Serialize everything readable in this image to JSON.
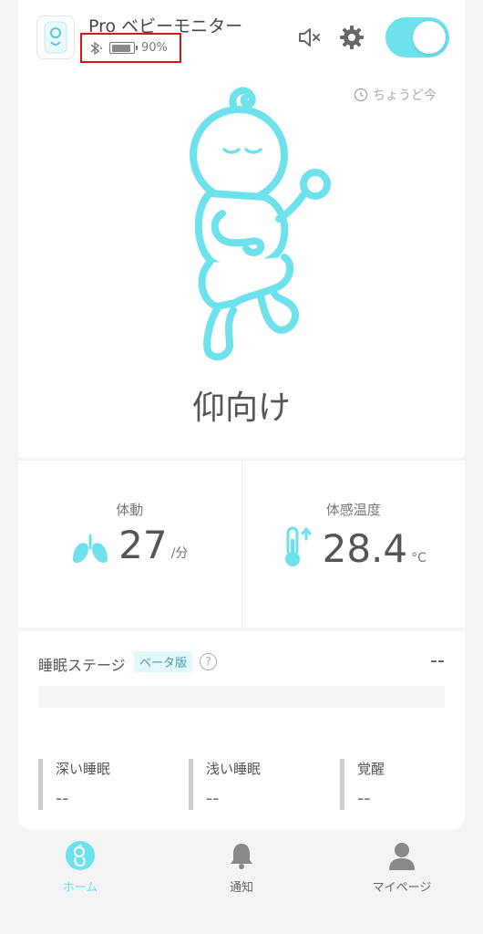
{
  "header": {
    "device_name": "Pro ベビーモニター",
    "battery_percent": 90,
    "battery_label": "90%",
    "bluetooth_icon": "bluetooth-icon",
    "mute_icon": "speaker-mute-icon",
    "settings_icon": "gear-icon",
    "monitor_enabled": true
  },
  "now_link": {
    "label": "ちょうど今"
  },
  "posture": {
    "label": "仰向け"
  },
  "stats": {
    "movement": {
      "label": "体動",
      "value": "27",
      "unit": "/分"
    },
    "temperature": {
      "label": "体感温度",
      "value": "28.4",
      "unit": "°C"
    }
  },
  "sleep": {
    "title": "睡眠ステージ",
    "beta": "ベータ版",
    "help": "?",
    "value": "--",
    "legend": [
      {
        "label": "深い睡眠",
        "value": "--"
      },
      {
        "label": "浅い睡眠",
        "value": "--"
      },
      {
        "label": "覚醒",
        "value": "--"
      }
    ]
  },
  "tabs": [
    {
      "label": "ホーム",
      "active": true
    },
    {
      "label": "通知",
      "active": false
    },
    {
      "label": "マイページ",
      "active": false
    }
  ],
  "colors": {
    "accent": "#6de1ec",
    "highlight_border": "#d9151f",
    "inactive": "#888888"
  }
}
